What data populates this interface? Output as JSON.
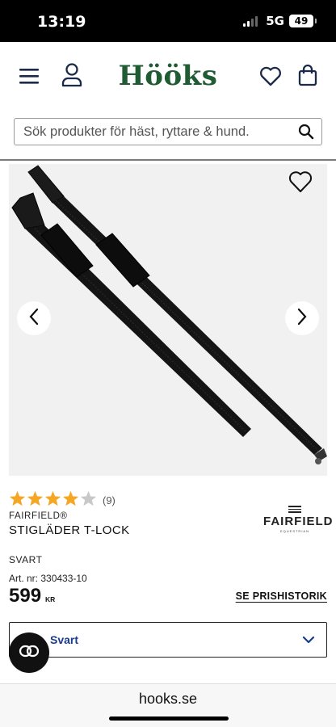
{
  "status": {
    "time": "13:19",
    "network": "5G",
    "battery": "49"
  },
  "header": {
    "logo": "Hööks"
  },
  "search": {
    "placeholder": "Sök produkter för häst, ryttare & hund."
  },
  "product": {
    "rating": {
      "stars": 4,
      "max": 5,
      "count_label": "(9)"
    },
    "brand": "FAIRFIELD®",
    "title": "STIGLÄDER T-LOCK",
    "brand_logo": {
      "name": "FAIRFIELD",
      "sub": "EQUESTRIAN"
    },
    "color": "SVART",
    "art_nr": "Art. nr: 330433-10",
    "price": "599",
    "currency": "KR",
    "history_link": "SE PRISHISTORIK",
    "variant_selected": "Svart"
  },
  "browser": {
    "url": "hooks.se"
  },
  "colors": {
    "brand_green": "#1f5b33",
    "star": "#f5a623",
    "link_blue": "#1a3a8a"
  }
}
